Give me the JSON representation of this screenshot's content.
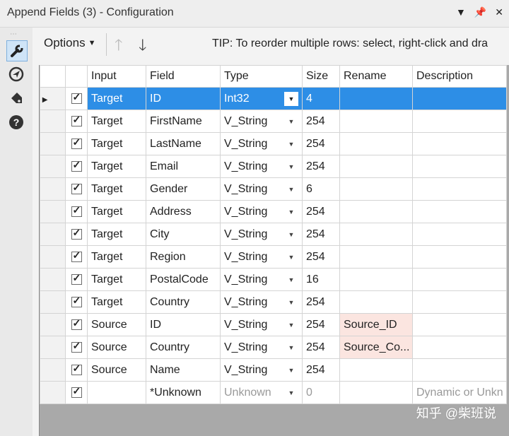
{
  "window": {
    "title": "Append Fields (3) - Configuration"
  },
  "toolbar": {
    "options_label": "Options",
    "tip": "TIP: To reorder multiple rows: select, right-click and dra"
  },
  "grid": {
    "columns": [
      "Input",
      "Field",
      "Type",
      "Size",
      "Rename",
      "Description"
    ],
    "rows": [
      {
        "input": "Target",
        "field": "ID",
        "type": "Int32",
        "size": "4",
        "rename": "",
        "description": ""
      },
      {
        "input": "Target",
        "field": "FirstName",
        "type": "V_String",
        "size": "254",
        "rename": "",
        "description": ""
      },
      {
        "input": "Target",
        "field": "LastName",
        "type": "V_String",
        "size": "254",
        "rename": "",
        "description": ""
      },
      {
        "input": "Target",
        "field": "Email",
        "type": "V_String",
        "size": "254",
        "rename": "",
        "description": ""
      },
      {
        "input": "Target",
        "field": "Gender",
        "type": "V_String",
        "size": "6",
        "rename": "",
        "description": ""
      },
      {
        "input": "Target",
        "field": "Address",
        "type": "V_String",
        "size": "254",
        "rename": "",
        "description": ""
      },
      {
        "input": "Target",
        "field": "City",
        "type": "V_String",
        "size": "254",
        "rename": "",
        "description": ""
      },
      {
        "input": "Target",
        "field": "Region",
        "type": "V_String",
        "size": "254",
        "rename": "",
        "description": ""
      },
      {
        "input": "Target",
        "field": "PostalCode",
        "type": "V_String",
        "size": "16",
        "rename": "",
        "description": ""
      },
      {
        "input": "Target",
        "field": "Country",
        "type": "V_String",
        "size": "254",
        "rename": "",
        "description": ""
      },
      {
        "input": "Source",
        "field": "ID",
        "type": "V_String",
        "size": "254",
        "rename": "Source_ID",
        "description": ""
      },
      {
        "input": "Source",
        "field": "Country",
        "type": "V_String",
        "size": "254",
        "rename": "Source_Co...",
        "description": ""
      },
      {
        "input": "Source",
        "field": "Name",
        "type": "V_String",
        "size": "254",
        "rename": "",
        "description": ""
      },
      {
        "input": "",
        "field": "*Unknown",
        "type": "Unknown",
        "size": "0",
        "rename": "",
        "description": "Dynamic or Unkn"
      }
    ]
  },
  "watermark": "知乎 @柴班说",
  "colors": {
    "selection": "#2d8ee6",
    "rename_highlight": "#fbe5e0"
  }
}
